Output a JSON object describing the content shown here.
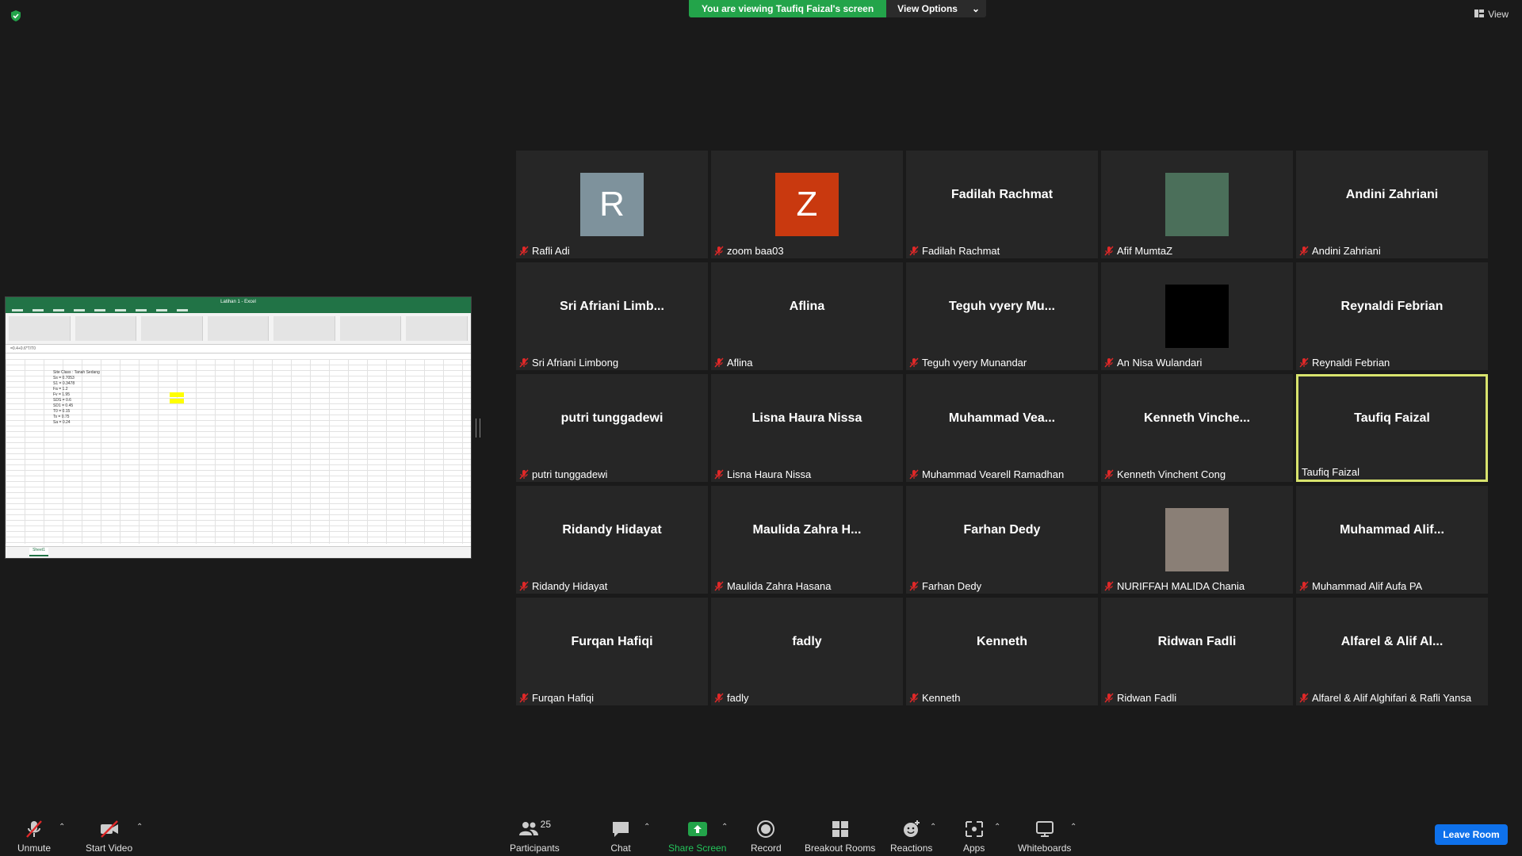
{
  "top": {
    "banner_text": "You are viewing Taufiq Faizal's screen",
    "view_options": "View Options",
    "view_button": "View"
  },
  "shared_screen": {
    "window_title": "Latihan 1 - Excel",
    "formula": "=0.4+0.6*T/T0",
    "sheet_tab": "Sheet1",
    "cells": [
      "Site Class : Tanah Sedang",
      "Ss = 0.7053",
      "S1 = 0.3478",
      "Fa = 1.2",
      "Fv = 1.95",
      "SDS = 0.6",
      "SD1 = 0.45",
      "T0 = 0.15",
      "Ts = 0.75",
      "Sa = 0.24"
    ]
  },
  "participants": [
    {
      "display": "R",
      "name": "Rafli Adi",
      "type": "letter",
      "color": "#7e929c",
      "muted": true
    },
    {
      "display": "Z",
      "name": "zoom baa03",
      "type": "letter",
      "color": "#c9390f",
      "muted": true
    },
    {
      "display": "Fadilah Rachmat",
      "name": "Fadilah Rachmat",
      "type": "text",
      "muted": true
    },
    {
      "display": "",
      "name": "Afif MumtaZ",
      "type": "photo",
      "color": "#4b6f5a",
      "muted": true
    },
    {
      "display": "Andini Zahriani",
      "name": "Andini Zahriani",
      "type": "text",
      "muted": true
    },
    {
      "display": "Sri Afriani Limb...",
      "name": "Sri Afriani Limbong",
      "type": "text",
      "muted": true
    },
    {
      "display": "Aflina",
      "name": "Aflina",
      "type": "text",
      "muted": true
    },
    {
      "display": "Teguh vyery Mu...",
      "name": "Teguh vyery Munandar",
      "type": "text",
      "muted": true
    },
    {
      "display": "",
      "name": "An Nisa Wulandari",
      "type": "photo",
      "color": "#000000",
      "muted": true
    },
    {
      "display": "Reynaldi Febrian",
      "name": "Reynaldi Febrian",
      "type": "text",
      "muted": true
    },
    {
      "display": "putri tunggadewi",
      "name": "putri tunggadewi",
      "type": "text",
      "muted": true
    },
    {
      "display": "Lisna Haura Nissa",
      "name": "Lisna Haura Nissa",
      "type": "text",
      "muted": true
    },
    {
      "display": "Muhammad Vea...",
      "name": "Muhammad Vearell Ramadhan",
      "type": "text",
      "muted": true
    },
    {
      "display": "Kenneth Vinche...",
      "name": "Kenneth Vinchent Cong",
      "type": "text",
      "muted": true
    },
    {
      "display": "Taufiq Faizal",
      "name": "Taufiq Faizal",
      "type": "text",
      "muted": false,
      "active": true
    },
    {
      "display": "Ridandy Hidayat",
      "name": "Ridandy Hidayat",
      "type": "text",
      "muted": true
    },
    {
      "display": "Maulida Zahra H...",
      "name": "Maulida Zahra Hasana",
      "type": "text",
      "muted": true
    },
    {
      "display": "Farhan Dedy",
      "name": "Farhan Dedy",
      "type": "text",
      "muted": true
    },
    {
      "display": "",
      "name": "NURIFFAH MALIDA Chania",
      "type": "photo",
      "color": "#8a7f76",
      "muted": true
    },
    {
      "display": "Muhammad Alif...",
      "name": "Muhammad Alif Aufa PA",
      "type": "text",
      "muted": true
    },
    {
      "display": "Furqan Hafiqi",
      "name": "Furqan Hafiqi",
      "type": "text",
      "muted": true
    },
    {
      "display": "fadly",
      "name": "fadly",
      "type": "text",
      "muted": true
    },
    {
      "display": "Kenneth",
      "name": "Kenneth",
      "type": "text",
      "muted": true
    },
    {
      "display": "Ridwan Fadli",
      "name": "Ridwan Fadli",
      "type": "text",
      "muted": true
    },
    {
      "display": "Alfarel & Alif Al...",
      "name": "Alfarel & Alif Alghifari & Rafli Yansa",
      "type": "text",
      "muted": true
    }
  ],
  "toolbar": {
    "unmute": "Unmute",
    "start_video": "Start Video",
    "participants": "Participants",
    "participants_count": "25",
    "chat": "Chat",
    "share_screen": "Share Screen",
    "record": "Record",
    "breakout_rooms": "Breakout Rooms",
    "reactions": "Reactions",
    "apps": "Apps",
    "whiteboards": "Whiteboards",
    "leave_room": "Leave Room"
  },
  "colors": {
    "share_green": "#23a44a",
    "leave_blue": "#0e71eb",
    "active_border": "#d8e36d",
    "muted_red": "#e02828"
  }
}
